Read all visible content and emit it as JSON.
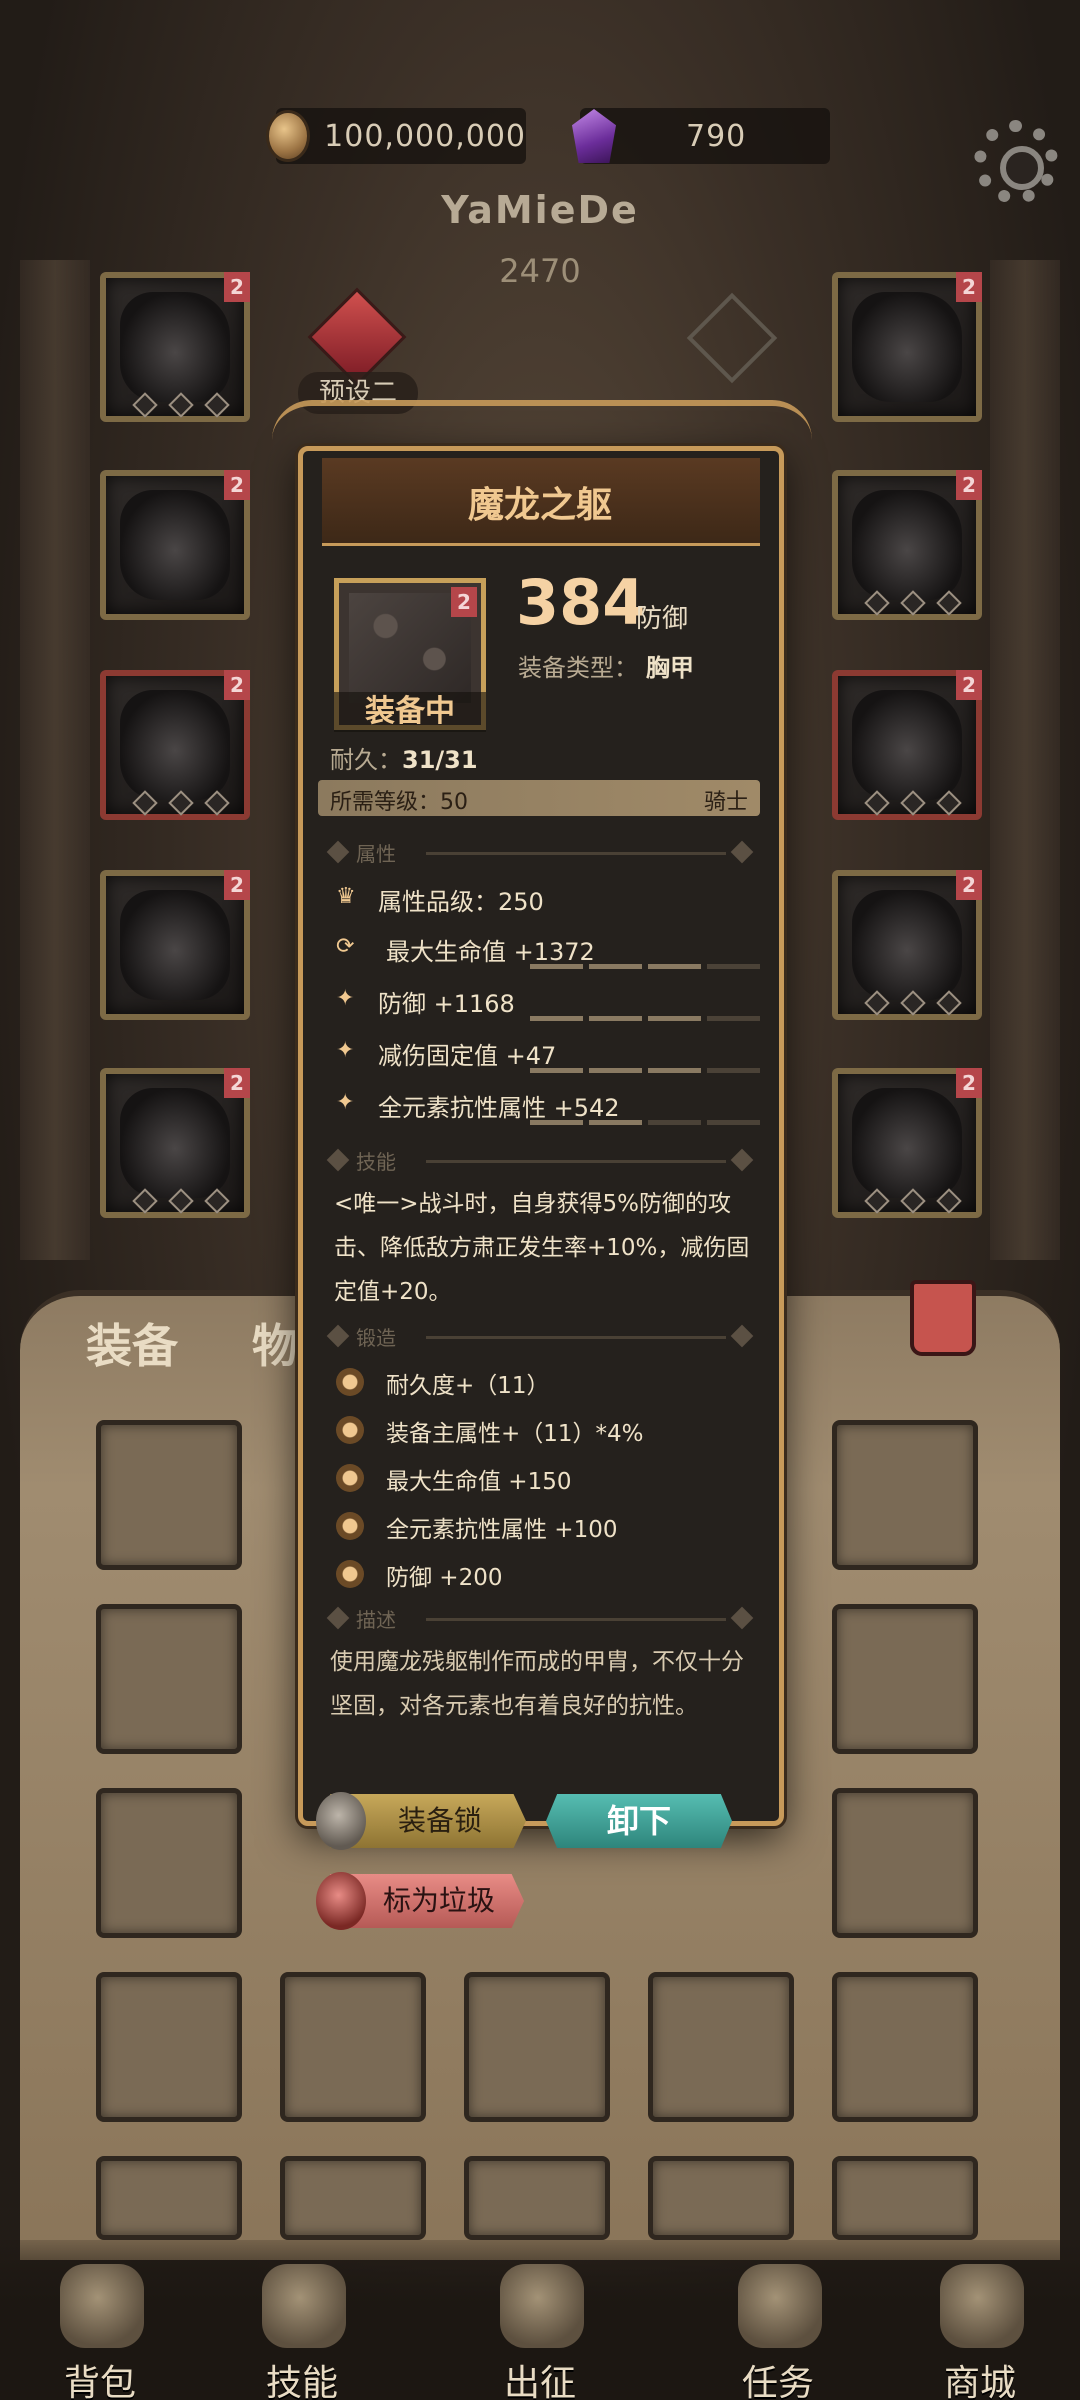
{
  "currency": {
    "gold": "100,000,000",
    "gems": "790"
  },
  "player": {
    "name": "YaMieDe",
    "power": "2470",
    "preset_label": "预设二"
  },
  "equipment_slots": {
    "left": [
      {
        "badge": "2",
        "frame": "gold"
      },
      {
        "badge": "2",
        "frame": "gold"
      },
      {
        "badge": "2",
        "frame": "red"
      },
      {
        "badge": "2",
        "frame": "gold"
      },
      {
        "badge": "2",
        "frame": "gold"
      }
    ],
    "right": [
      {
        "badge": "2",
        "frame": "gold"
      },
      {
        "badge": "2",
        "frame": "gold"
      },
      {
        "badge": "2",
        "frame": "red"
      },
      {
        "badge": "2",
        "frame": "gold"
      },
      {
        "badge": "2",
        "frame": "gold"
      }
    ]
  },
  "bag_tabs": {
    "equipment": "装备",
    "items": "物品"
  },
  "item": {
    "name": "魔龙之躯",
    "badge": "2",
    "equipped_label": "装备中",
    "main_value": "384",
    "main_unit": "防御",
    "type_label": "装备类型：",
    "type_value": "胸甲",
    "durability_label": "耐久：",
    "durability_value": "31/31",
    "level_label": "所需等级：50",
    "class_label": "骑士",
    "sections": {
      "attributes": "属性",
      "skill": "技能",
      "forge": "锻造",
      "description": "描述"
    },
    "attributes": [
      {
        "icon": "quality-crown-icon",
        "text": "属性品级：250",
        "bar": null
      },
      {
        "icon": "refresh-icon",
        "text": "最大生命值 +1372",
        "bar": 0.6
      },
      {
        "icon": "sparkle-icon",
        "text": "防御 +1168",
        "bar": 0.6
      },
      {
        "icon": "sparkle-icon",
        "text": "减伤固定值 +47",
        "bar": 0.6
      },
      {
        "icon": "sparkle-icon",
        "text": "全元素抗性属性 +542",
        "bar": 0.4
      }
    ],
    "skill_text": "<唯一>战斗时，自身获得5%防御的攻击、降低敌方肃正发生率+10%，减伤固定值+20。",
    "forge": [
      "耐久度+（11）",
      "装备主属性+（11）*4%",
      "最大生命值 +150",
      "全元素抗性属性 +100",
      "防御 +200"
    ],
    "description": "使用魔龙残躯制作而成的甲胄，不仅十分坚固，对各元素也有着良好的抗性。"
  },
  "actions": {
    "lock": "装备锁",
    "unequip": "卸下",
    "mark_junk": "标为垃圾"
  },
  "bottom_nav": [
    {
      "label": "背包",
      "icon": "backpack-icon"
    },
    {
      "label": "技能",
      "icon": "skill-book-icon"
    },
    {
      "label": "出征",
      "icon": "battle-sword-icon"
    },
    {
      "label": "任务",
      "icon": "scroll-icon"
    },
    {
      "label": "商城",
      "icon": "shop-icon"
    }
  ],
  "colors": {
    "accent_gold": "#c79a5a",
    "unequip_teal": "#56bdb2",
    "junk_red": "#e88c86",
    "badge_red": "#b5464a"
  }
}
